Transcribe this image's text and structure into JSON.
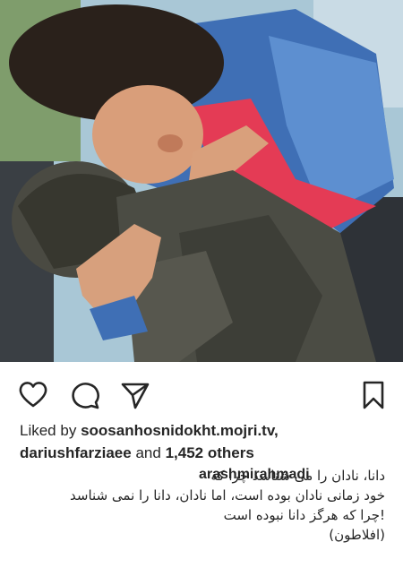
{
  "post": {
    "likes": {
      "prefix": "Liked by",
      "user1": "soosanhosnidokht.mojri.tv,",
      "user2": "dariushfarziaee",
      "and": "and",
      "others": "1,452 others"
    },
    "caption": {
      "username": "arashmirahmadi",
      "line1": "دانا، نادان را می شناسد چرا که",
      "line2": "خود زمانی نادان بوده است، اما نادان، دانا را نمی شناسد",
      "line3": "!چرا که هرگز دانا نبوده است",
      "line4": "(افلاطون)"
    }
  },
  "icons": {
    "like": "heart-icon",
    "comment": "comment-icon",
    "share": "paper-plane-icon",
    "save": "bookmark-icon"
  },
  "colors": {
    "text": "#262626",
    "icon": "#262626",
    "background": "#ffffff"
  }
}
